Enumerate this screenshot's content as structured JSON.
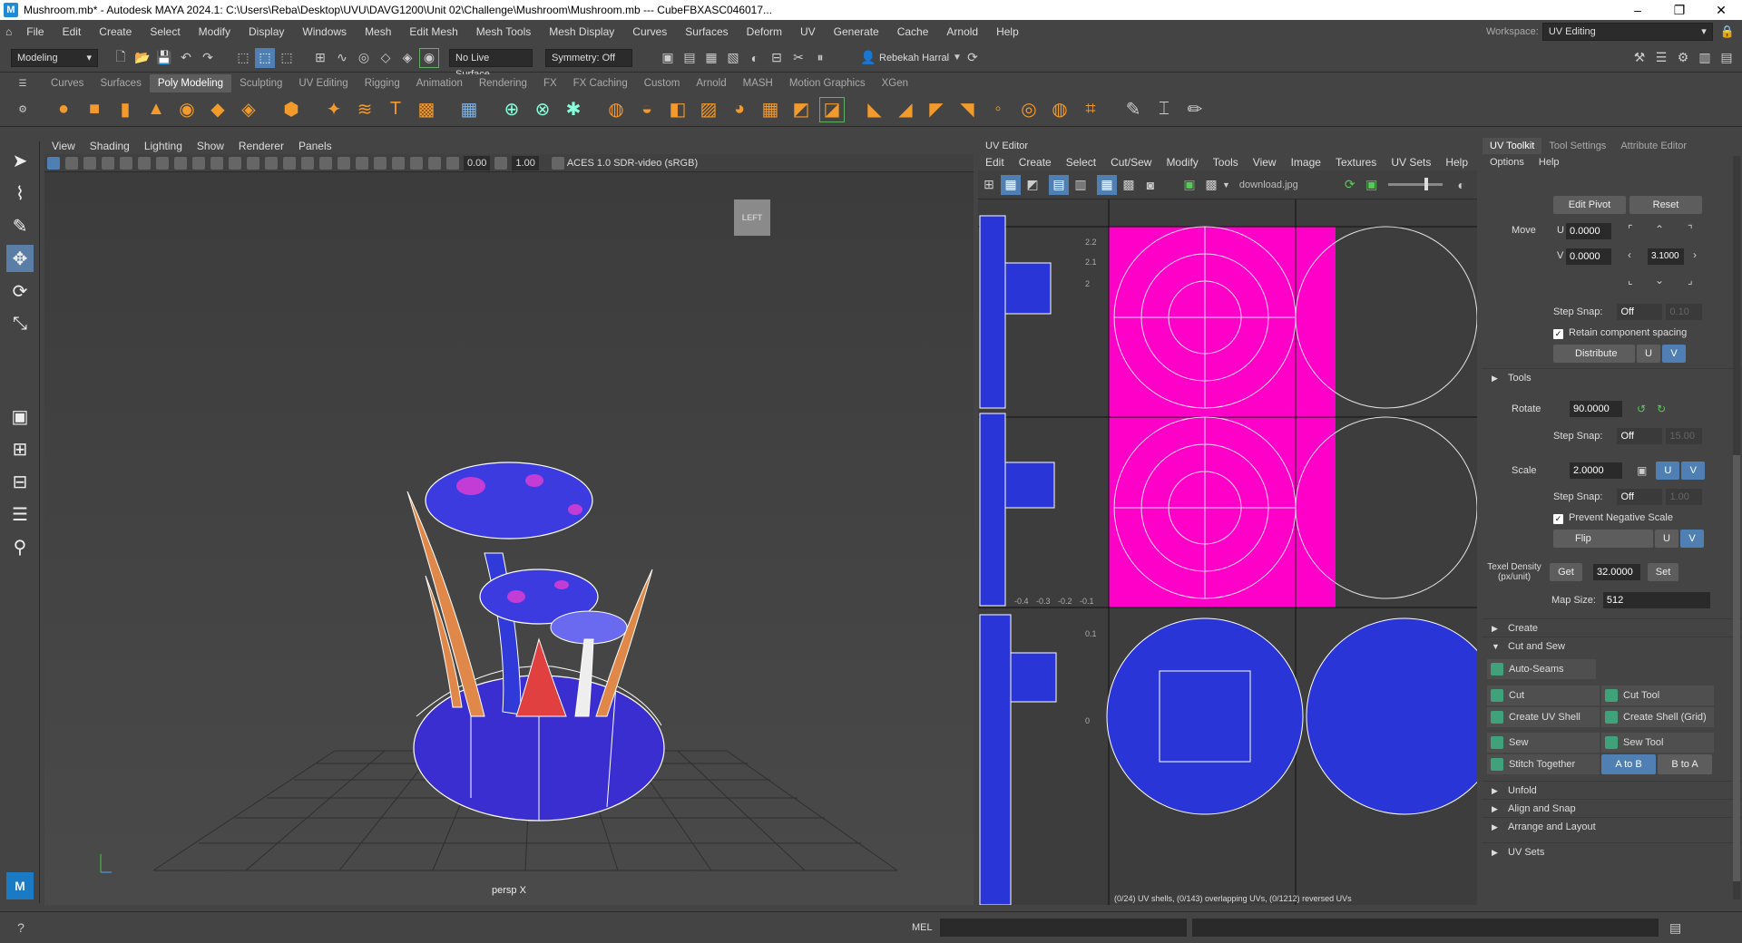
{
  "title": "Mushroom.mb* - Autodesk MAYA 2024.1: C:\\Users\\Reba\\Desktop\\UVU\\DAVG1200\\Unit 02\\Challenge\\Mushroom\\Mushroom.mb   ---   CubeFBXASC046017...",
  "menu": [
    "File",
    "Edit",
    "Create",
    "Select",
    "Modify",
    "Display",
    "Windows",
    "Mesh",
    "Edit Mesh",
    "Mesh Tools",
    "Mesh Display",
    "Curves",
    "Surfaces",
    "Deform",
    "UV",
    "Generate",
    "Cache",
    "Arnold",
    "Help"
  ],
  "workspace": {
    "label": "Workspace:",
    "value": "UV Editing"
  },
  "status": {
    "mode": "Modeling",
    "live_surface": "No Live Surface",
    "symmetry": "Symmetry: Off",
    "user": "Rebekah Harral"
  },
  "shelf_tabs": [
    "Curves",
    "Surfaces",
    "Poly Modeling",
    "Sculpting",
    "UV Editing",
    "Rigging",
    "Animation",
    "Rendering",
    "FX",
    "FX Caching",
    "Custom",
    "Arnold",
    "MASH",
    "Motion Graphics",
    "XGen"
  ],
  "shelf_active": "Poly Modeling",
  "viewport": {
    "menu": [
      "View",
      "Shading",
      "Lighting",
      "Show",
      "Renderer",
      "Panels"
    ],
    "field1": "0.00",
    "field2": "1.00",
    "colorspace": "ACES 1.0 SDR-video (sRGB)",
    "camera": "persp X",
    "cube": "LEFT"
  },
  "uv_editor": {
    "title": "UV Editor",
    "menu": [
      "Edit",
      "Create",
      "Select",
      "Cut/Sew",
      "Modify",
      "Tools",
      "View",
      "Image",
      "Textures",
      "UV Sets",
      "Help"
    ],
    "image": "download.jpg",
    "hud": "(0/24) UV shells, (0/143) overlapping UVs, (0/1212) reversed UVs",
    "ticks_v": [
      "2.2",
      "2.1",
      "2",
      "0.1",
      "0"
    ],
    "ticks_u": [
      "-0.4",
      "-0.3",
      "-0.2",
      "-0.1"
    ]
  },
  "toolkit": {
    "tabs": [
      "UV Toolkit",
      "Tool Settings",
      "Attribute Editor"
    ],
    "submenu": [
      "Options",
      "Help"
    ],
    "edit_pivot": "Edit Pivot",
    "reset": "Reset",
    "move": {
      "label": "Move",
      "u_label": "U",
      "u": "0.0000",
      "v_label": "V",
      "v": "0.0000",
      "step": "3.1000"
    },
    "step_snap_label": "Step Snap:",
    "step_snap": "Off",
    "step_vals": [
      "0.10",
      "15.00",
      "1.00"
    ],
    "retain": "Retain component spacing",
    "distribute": "Distribute",
    "u": "U",
    "v": "V",
    "tools": "Tools",
    "rotate": {
      "label": "Rotate",
      "value": "90.0000"
    },
    "scale": {
      "label": "Scale",
      "value": "2.0000"
    },
    "prevent": "Prevent Negative Scale",
    "flip": "Flip",
    "texel": {
      "label": "Texel Density (px/unit)",
      "get": "Get",
      "value": "32.0000",
      "set": "Set",
      "map_label": "Map Size:",
      "map": "512"
    },
    "create": "Create",
    "cut_sew": "Cut and Sew",
    "buttons": [
      "Auto-Seams",
      "Cut",
      "Cut Tool",
      "Create UV Shell",
      "Create Shell (Grid)",
      "Sew",
      "Sew Tool",
      "Stitch Together",
      "A to B",
      "B to A"
    ],
    "sections": [
      "Unfold",
      "Align and Snap",
      "Arrange and Layout",
      "UV Sets"
    ]
  },
  "cmd": {
    "label": "MEL"
  }
}
